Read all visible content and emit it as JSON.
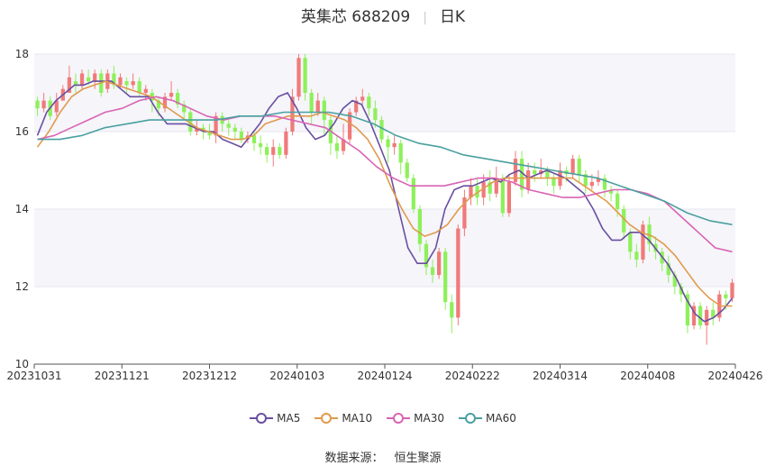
{
  "header": {
    "stock_name": "英集芯 688209",
    "period": "日K"
  },
  "source": {
    "label": "数据来源：",
    "value": "恒生聚源"
  },
  "colors": {
    "up": "#f07a7a",
    "down": "#8ef05a",
    "ma5": "#6a4fa0",
    "ma10": "#e09a4c",
    "ma30": "#d964b4",
    "ma60": "#4aa0a0",
    "grid": "#e6e6f0",
    "band": "#f5f5fa"
  },
  "chart_data": {
    "type": "candlestick",
    "ylim": [
      10,
      18
    ],
    "yticks": [
      "10",
      "12",
      "14",
      "16",
      "18"
    ],
    "xticks": [
      "20231031",
      "20231121",
      "20231212",
      "20240103",
      "20240124",
      "20240222",
      "20240314",
      "20240408",
      "20240426"
    ],
    "candles": [
      [
        16.8,
        16.6,
        16.9,
        16.4
      ],
      [
        16.6,
        16.8,
        17.0,
        16.5
      ],
      [
        16.8,
        16.4,
        16.9,
        16.3
      ],
      [
        16.5,
        16.8,
        17.0,
        16.4
      ],
      [
        16.8,
        17.1,
        17.2,
        16.8
      ],
      [
        17.0,
        17.4,
        17.7,
        17.0
      ],
      [
        17.3,
        17.2,
        17.5,
        17.0
      ],
      [
        17.2,
        17.5,
        17.6,
        17.1
      ],
      [
        17.4,
        17.3,
        17.6,
        17.2
      ],
      [
        17.3,
        17.5,
        17.6,
        17.1
      ],
      [
        17.5,
        17.0,
        17.6,
        16.9
      ],
      [
        17.1,
        17.5,
        17.6,
        17.0
      ],
      [
        17.5,
        17.2,
        17.7,
        17.1
      ],
      [
        17.2,
        17.4,
        17.5,
        17.1
      ],
      [
        17.3,
        17.2,
        17.4,
        17.0
      ],
      [
        17.2,
        17.3,
        17.5,
        17.1
      ],
      [
        17.3,
        17.0,
        17.4,
        16.9
      ],
      [
        17.0,
        17.1,
        17.2,
        16.8
      ],
      [
        17.0,
        16.8,
        17.1,
        16.5
      ],
      [
        16.8,
        16.6,
        16.9,
        16.4
      ],
      [
        16.6,
        16.9,
        17.0,
        16.5
      ],
      [
        16.9,
        17.0,
        17.3,
        16.8
      ],
      [
        17.0,
        16.7,
        17.1,
        16.6
      ],
      [
        16.7,
        16.5,
        16.8,
        16.3
      ],
      [
        16.5,
        16.0,
        16.6,
        15.9
      ],
      [
        16.0,
        16.1,
        16.3,
        15.9
      ],
      [
        16.1,
        16.0,
        16.2,
        15.8
      ],
      [
        16.0,
        15.9,
        16.2,
        15.8
      ],
      [
        15.9,
        16.4,
        16.5,
        15.7
      ],
      [
        16.4,
        16.2,
        16.5,
        16.0
      ],
      [
        16.2,
        16.1,
        16.3,
        15.9
      ],
      [
        16.1,
        16.0,
        16.2,
        15.8
      ],
      [
        16.0,
        15.8,
        16.1,
        15.7
      ],
      [
        15.8,
        15.9,
        16.0,
        15.7
      ],
      [
        15.9,
        15.7,
        16.0,
        15.5
      ],
      [
        15.7,
        15.6,
        15.9,
        15.4
      ],
      [
        15.6,
        15.4,
        15.7,
        15.2
      ],
      [
        15.4,
        15.6,
        15.8,
        15.1
      ],
      [
        15.6,
        15.4,
        15.7,
        15.3
      ],
      [
        15.4,
        16.0,
        16.1,
        15.3
      ],
      [
        16.0,
        16.9,
        17.1,
        15.9
      ],
      [
        16.9,
        17.9,
        18.0,
        16.8
      ],
      [
        17.9,
        17.0,
        18.0,
        16.8
      ],
      [
        17.0,
        16.5,
        17.1,
        16.2
      ],
      [
        16.5,
        16.8,
        17.0,
        16.4
      ],
      [
        16.8,
        16.3,
        16.9,
        15.9
      ],
      [
        16.3,
        15.7,
        16.4,
        15.4
      ],
      [
        15.7,
        15.5,
        15.9,
        15.3
      ],
      [
        15.5,
        15.8,
        16.2,
        15.4
      ],
      [
        15.8,
        16.5,
        16.6,
        15.7
      ],
      [
        16.5,
        16.8,
        16.9,
        16.4
      ],
      [
        16.8,
        16.9,
        17.1,
        16.7
      ],
      [
        16.9,
        16.6,
        17.0,
        16.4
      ],
      [
        16.6,
        16.3,
        16.8,
        16.1
      ],
      [
        16.3,
        15.8,
        16.4,
        15.7
      ],
      [
        15.8,
        15.6,
        15.9,
        15.2
      ],
      [
        15.6,
        15.7,
        15.9,
        15.4
      ],
      [
        15.7,
        15.2,
        15.8,
        14.9
      ],
      [
        15.2,
        14.8,
        15.3,
        14.7
      ],
      [
        14.8,
        14.0,
        14.9,
        13.9
      ],
      [
        14.0,
        13.1,
        14.1,
        12.9
      ],
      [
        13.1,
        12.5,
        13.2,
        12.3
      ],
      [
        12.5,
        12.3,
        12.7,
        12.1
      ],
      [
        12.3,
        12.9,
        13.0,
        12.2
      ],
      [
        12.9,
        11.6,
        13.0,
        11.4
      ],
      [
        11.6,
        11.2,
        11.8,
        10.8
      ],
      [
        11.2,
        13.5,
        13.6,
        11.0
      ],
      [
        13.5,
        14.3,
        14.5,
        13.3
      ],
      [
        14.3,
        14.6,
        14.8,
        14.1
      ],
      [
        14.6,
        14.3,
        14.8,
        14.1
      ],
      [
        14.3,
        14.7,
        14.9,
        14.1
      ],
      [
        14.7,
        14.4,
        15.0,
        14.2
      ],
      [
        14.4,
        14.8,
        15.1,
        14.3
      ],
      [
        14.8,
        13.9,
        14.9,
        13.8
      ],
      [
        13.9,
        14.7,
        14.9,
        13.8
      ],
      [
        14.7,
        15.3,
        15.5,
        14.6
      ],
      [
        15.3,
        14.5,
        15.5,
        14.3
      ],
      [
        14.5,
        15.0,
        15.2,
        14.4
      ],
      [
        15.0,
        14.9,
        15.2,
        14.7
      ],
      [
        14.9,
        15.0,
        15.3,
        14.8
      ],
      [
        15.0,
        14.8,
        15.1,
        14.6
      ],
      [
        14.8,
        14.6,
        14.9,
        14.4
      ],
      [
        14.6,
        15.0,
        15.2,
        14.5
      ],
      [
        15.0,
        14.9,
        15.1,
        14.7
      ],
      [
        14.9,
        15.3,
        15.4,
        14.8
      ],
      [
        15.3,
        14.9,
        15.4,
        14.7
      ],
      [
        14.9,
        14.6,
        15.0,
        14.4
      ],
      [
        14.6,
        14.7,
        14.9,
        14.5
      ],
      [
        14.7,
        14.8,
        15.0,
        14.6
      ],
      [
        14.8,
        14.5,
        14.9,
        14.3
      ],
      [
        14.5,
        14.4,
        14.6,
        14.2
      ],
      [
        14.4,
        14.0,
        14.5,
        13.8
      ],
      [
        14.0,
        13.4,
        14.1,
        13.2
      ],
      [
        13.4,
        12.9,
        13.5,
        12.7
      ],
      [
        12.9,
        12.7,
        13.1,
        12.5
      ],
      [
        12.7,
        13.6,
        13.7,
        12.6
      ],
      [
        13.6,
        13.1,
        13.8,
        12.9
      ],
      [
        13.1,
        12.9,
        13.3,
        12.7
      ],
      [
        12.9,
        12.6,
        13.0,
        12.4
      ],
      [
        12.6,
        12.3,
        12.8,
        12.1
      ],
      [
        12.3,
        12.0,
        12.4,
        11.8
      ],
      [
        12.0,
        11.8,
        12.1,
        11.6
      ],
      [
        11.8,
        11.0,
        11.9,
        10.8
      ],
      [
        11.0,
        11.5,
        11.6,
        10.9
      ],
      [
        11.5,
        11.0,
        11.6,
        10.9
      ],
      [
        11.0,
        11.4,
        11.5,
        10.5
      ],
      [
        11.4,
        11.2,
        11.6,
        11.0
      ],
      [
        11.2,
        11.8,
        11.9,
        11.1
      ],
      [
        11.8,
        11.7,
        11.9,
        11.4
      ],
      [
        11.7,
        12.1,
        12.2,
        11.6
      ]
    ],
    "series": [
      {
        "name": "MA5",
        "values": [
          15.9,
          16.5,
          16.8,
          17.0,
          17.2,
          17.2,
          17.3,
          17.3,
          17.3,
          17.1,
          16.9,
          16.9,
          16.9,
          16.5,
          16.2,
          16.2,
          16.2,
          16.1,
          16.0,
          16.0,
          15.8,
          15.7,
          15.6,
          15.9,
          16.2,
          16.6,
          16.9,
          17.0,
          16.6,
          16.1,
          15.8,
          15.9,
          16.2,
          16.6,
          16.8,
          16.7,
          16.2,
          15.6,
          15.0,
          14.0,
          13.0,
          12.6,
          12.6,
          13.0,
          14.0,
          14.5,
          14.6,
          14.6,
          14.7,
          14.8,
          14.7,
          14.9,
          15.0,
          14.8,
          14.9,
          15.0,
          14.9,
          14.8,
          14.6,
          14.4,
          14.0,
          13.5,
          13.2,
          13.2,
          13.4,
          13.4,
          13.2,
          12.9,
          12.6,
          12.2,
          11.7,
          11.3,
          11.1,
          11.2,
          11.4,
          11.7
        ]
      },
      {
        "name": "MA10",
        "values": [
          15.6,
          16.0,
          16.5,
          16.9,
          17.1,
          17.2,
          17.3,
          17.2,
          17.1,
          17.0,
          16.9,
          16.7,
          16.5,
          16.3,
          16.1,
          16.0,
          15.9,
          15.8,
          15.8,
          15.9,
          16.2,
          16.3,
          16.4,
          16.4,
          16.4,
          16.5,
          16.4,
          16.3,
          16.1,
          15.8,
          15.3,
          14.6,
          14.0,
          13.5,
          13.3,
          13.4,
          13.6,
          14.0,
          14.3,
          14.5,
          14.7,
          14.8,
          14.8,
          14.8,
          14.8,
          14.8,
          14.8,
          14.8,
          14.6,
          14.4,
          14.2,
          13.9,
          13.6,
          13.4,
          13.3,
          13.1,
          12.8,
          12.4,
          12.0,
          11.7,
          11.5,
          11.5
        ]
      },
      {
        "name": "MA30",
        "values": [
          15.8,
          15.9,
          16.1,
          16.3,
          16.5,
          16.6,
          16.8,
          16.9,
          16.8,
          16.6,
          16.4,
          16.3,
          16.4,
          16.4,
          16.4,
          16.3,
          16.2,
          16.1,
          15.8,
          15.5,
          15.1,
          14.8,
          14.6,
          14.6,
          14.6,
          14.7,
          14.8,
          14.8,
          14.7,
          14.5,
          14.4,
          14.3,
          14.3,
          14.4,
          14.5,
          14.5,
          14.4,
          14.2,
          13.8,
          13.4,
          13.0,
          12.9
        ]
      },
      {
        "name": "MA60",
        "values": [
          15.8,
          15.8,
          15.9,
          16.1,
          16.2,
          16.3,
          16.3,
          16.3,
          16.3,
          16.4,
          16.4,
          16.5,
          16.5,
          16.5,
          16.4,
          16.2,
          15.9,
          15.7,
          15.6,
          15.4,
          15.3,
          15.2,
          15.1,
          15.0,
          14.9,
          14.8,
          14.6,
          14.4,
          14.2,
          13.9,
          13.7,
          13.6
        ]
      }
    ],
    "legend": [
      "MA5",
      "MA10",
      "MA30",
      "MA60"
    ]
  }
}
